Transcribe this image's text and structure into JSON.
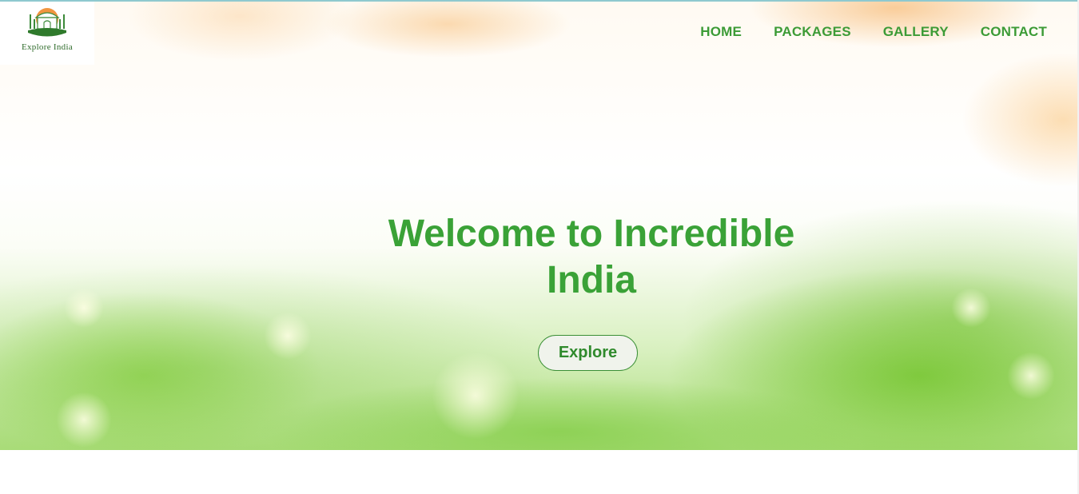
{
  "header": {
    "logo": {
      "icon": "taj-mahal-logo-icon",
      "text": "Explore India",
      "colors": {
        "sun": "#f08a2b",
        "dome": "#3c8a3a",
        "ground": "#2f7a2c"
      }
    },
    "nav": [
      {
        "label": "HOME"
      },
      {
        "label": "PACKAGES"
      },
      {
        "label": "GALLERY"
      },
      {
        "label": "CONTACT"
      }
    ]
  },
  "hero": {
    "title_line1": "Welcome to Incredible",
    "title_line2": "India",
    "cta_label": "Explore"
  },
  "colors": {
    "accent": "#3aa237",
    "nav_text": "#3c9b36",
    "button_bg": "#f0f3ec",
    "button_border": "#3a8f35"
  }
}
